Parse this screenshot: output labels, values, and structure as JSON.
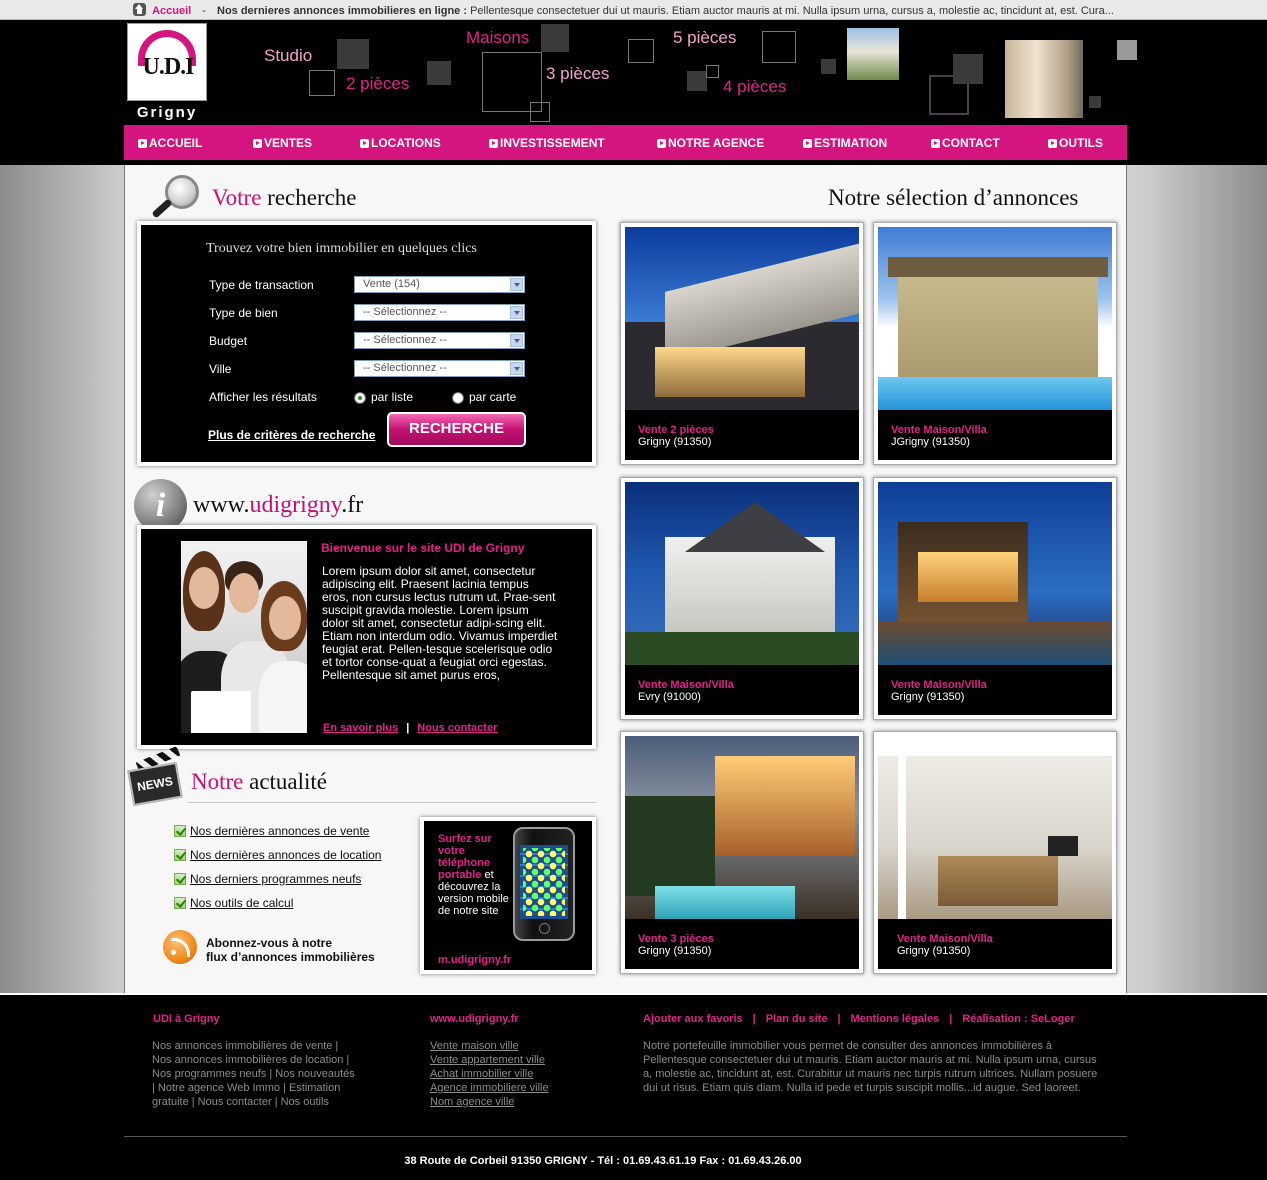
{
  "topbar": {
    "home": "Accueil",
    "sep": "-",
    "title": "Nos dernieres annonces immobilieres en ligne :",
    "text": "Pellentesque consectetuer dui ut mauris. Etiam auctor mauris at mi. Nulla ipsum urna, cursus a, molestie ac, tincidunt at, est. Cura..."
  },
  "logo": {
    "name": "U.D.I",
    "city": "Grigny"
  },
  "header_words": [
    "Studio",
    "2 pièces",
    "Maisons",
    "3 pièces",
    "5 pièces",
    "4 pièces"
  ],
  "nav": [
    "ACCUEIL",
    "VENTES",
    "LOCATIONS",
    "INVESTISSEMENT",
    "NOTRE AGENCE",
    "ESTIMATION",
    "CONTACT",
    "OUTILS"
  ],
  "search": {
    "title_pk": "Votre",
    "title_rest": "recherche",
    "heading": "Trouvez votre bien immobilier en quelques clics",
    "labels": [
      "Type de transaction",
      "Type de bien",
      "Budget",
      "Ville",
      "Afficher les résultats"
    ],
    "selects": [
      "Vente (154)",
      "-- Sélectionnez --",
      "-- Sélectionnez --",
      "-- Sélectionnez --"
    ],
    "radio_list": "par liste",
    "radio_map": "par carte",
    "more": "Plus de critères de recherche",
    "button": "RECHERCHE"
  },
  "site": {
    "www": "www.",
    "name": "udigrigny",
    "tld": ".fr",
    "welcome_title": "Bienvenue sur le site UDI de Grigny",
    "welcome_text": "Lorem ipsum dolor sit amet, consectetur adipiscing elit. Praesent lacinia tempus eros, non cursus lectus rutrum ut. Prae-sent suscipit gravida molestie. Lorem ipsum dolor sit amet, consectetur adipi-scing elit. Etiam non interdum odio. Vivamus imperdiet feugiat erat. Pellen-tesque scelerisque odio et tortor conse-quat a feugiat orci egestas. Pellentesque sit amet purus eros,",
    "link_more": "En savoir plus",
    "link_contact": "Nous contacter",
    "bar": "|"
  },
  "news": {
    "title_pk": "Notre",
    "title_rest": "actualité",
    "items": [
      "Nos dernières annonces de vente",
      "Nos dernières annonces de location",
      "Nos derniers programmes neufs",
      "Nos outils de calcul"
    ],
    "rss_line1": "Abonnez-vous à notre",
    "rss_line2": "flux d’annonces immobilières"
  },
  "mobile": {
    "pink": "Surfez sur votre téléphone portable",
    "text": "et découvrez la version mobile de notre site",
    "url": "m.udigrigny.fr"
  },
  "selection": {
    "title": "Notre sélection d’annonces",
    "items": [
      {
        "type": "Vente 2 pièces",
        "location": "Grigny (91350)"
      },
      {
        "type": "Vente Maison/Villa",
        "location": "JGrigny (91350)"
      },
      {
        "type": "Vente Maison/Villa",
        "location": "Evry (91000)"
      },
      {
        "type": "Vente Maison/Villa",
        "location": "Grigny (91350)"
      },
      {
        "type": "Vente 3 pièces",
        "location": "Grigny (91350)"
      },
      {
        "type": "Vente Maison/Villa",
        "location": "Grigny (91350)"
      }
    ]
  },
  "footer": {
    "col1_title": "UDI à Grigny",
    "col1_text": "Nos annonces immobilières de vente | Nos annonces immobilières de location | Nos programmes neufs | Nos nouveautés | Notre agence Web Immo | Estimation gratuite | Nous contacter | Nos outils",
    "col2_title": "www.udigrigny.fr",
    "col2_links": [
      "Vente maison ville",
      "Vente appartement ville",
      "Achat immobilier ville",
      "Agence immobiliere ville",
      "Nom agence ville"
    ],
    "top_links": [
      "Ajouter aux favoris",
      "Plan du site",
      "Mentions légales",
      "Réalisation : SeLoger"
    ],
    "col3_text": "Notre portefeuille immobilier vous permet de consulter des annonces immobilières à Pellentesque consectetuer dui ut mauris. Etiam auctor mauris at mi. Nulla ipsum urna, cursus a, molestie ac, tincidunt at, est. Curabitur ut mauris nec turpis rutrum ultrices. Nullam posuere dui ut risus. Etiam quis diam. Nulla id pede et turpis suscipit mollis...id augue. Sed laoreet.",
    "address": "38 Route de Corbeil 91350 GRIGNY -  Tél : 01.69.43.61.19  Fax : 01.69.43.26.00"
  },
  "colors": {
    "accent": "#d4147f",
    "background": "#000000",
    "content": "#f7f7f7"
  }
}
